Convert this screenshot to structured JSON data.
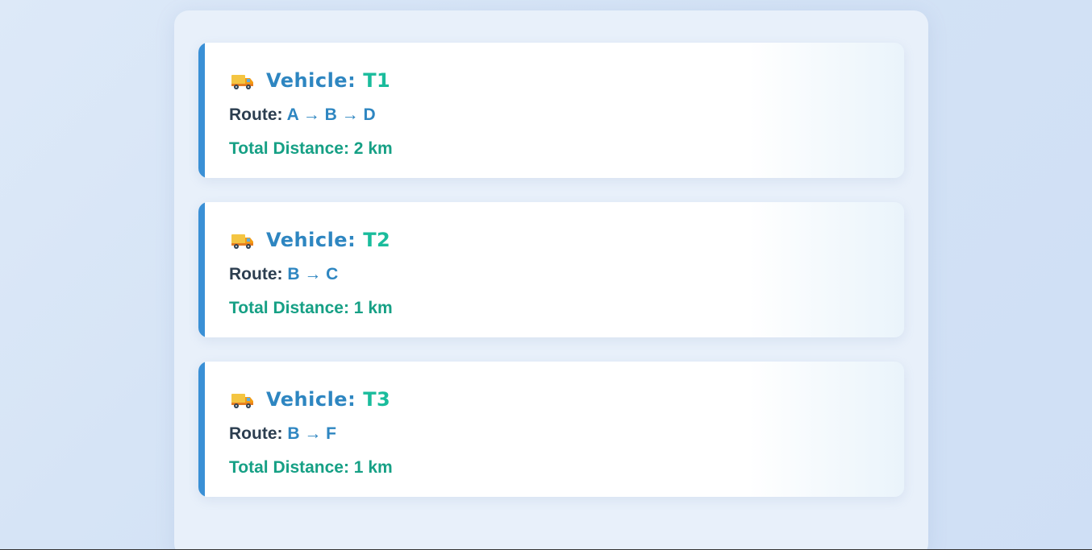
{
  "vehicles": [
    {
      "icon": "delivery-truck-icon",
      "vehicle_label": "Vehicle:",
      "vehicle_id": "T1",
      "route_label": "Route:",
      "route": "A → B → D",
      "distance": "Total Distance: 2 km"
    },
    {
      "icon": "delivery-truck-icon",
      "vehicle_label": "Vehicle:",
      "vehicle_id": "T2",
      "route_label": "Route:",
      "route": "B → C",
      "distance": "Total Distance: 1 km"
    },
    {
      "icon": "delivery-truck-icon",
      "vehicle_label": "Vehicle:",
      "vehicle_id": "T3",
      "route_label": "Route:",
      "route": "B → F",
      "distance": "Total Distance: 1 km"
    }
  ],
  "colors": {
    "accent_blue": "#2e86c1",
    "accent_teal": "#1abc9c",
    "distance_green": "#16a085",
    "card_border": "#3a90d6"
  }
}
